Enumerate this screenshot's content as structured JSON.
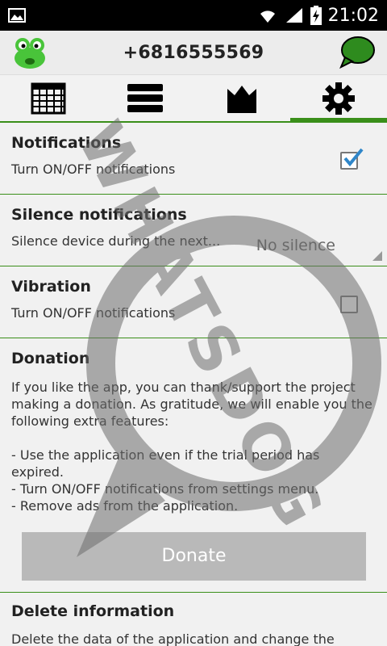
{
  "status_bar": {
    "time": "21:02",
    "icons": [
      "image-icon",
      "wifi-icon",
      "signal-icon",
      "battery-charging-icon"
    ]
  },
  "app_bar": {
    "title": "+6816555569",
    "logo_icon": "frog-logo-icon",
    "chat_icon": "chat-bubble-icon"
  },
  "tabs": [
    {
      "icon": "calendar-icon",
      "active": false
    },
    {
      "icon": "list-stack-icon",
      "active": false
    },
    {
      "icon": "crown-icon",
      "active": false
    },
    {
      "icon": "gear-icon",
      "active": true
    }
  ],
  "settings": {
    "notifications": {
      "title": "Notifications",
      "subtitle": "Turn ON/OFF notifications",
      "checked": true
    },
    "silence": {
      "title": "Silence notifications",
      "subtitle": "Silence device during the next...",
      "value": "No silence"
    },
    "vibration": {
      "title": "Vibration",
      "subtitle": "Turn ON/OFF notifications",
      "checked": false
    }
  },
  "donation": {
    "title": "Donation",
    "text": "If you like the app, you can thank/support the project making a donation. As gratitude, we will enable you the following extra features:\n\n - Use the application even if the trial period has expired.\n - Turn ON/OFF notifications from settings menu.\n - Remove ads from the application.",
    "button_label": "Donate"
  },
  "delete": {
    "title": "Delete information",
    "subtitle": "Delete the data of the application and change the"
  },
  "watermark": {
    "text": "WHATSDOG"
  },
  "colors": {
    "accent": "#3a8f1a",
    "checkbox_tick": "#2f86c9",
    "chat_bubble": "#2e8b1e",
    "button": "#b9b9b9"
  }
}
